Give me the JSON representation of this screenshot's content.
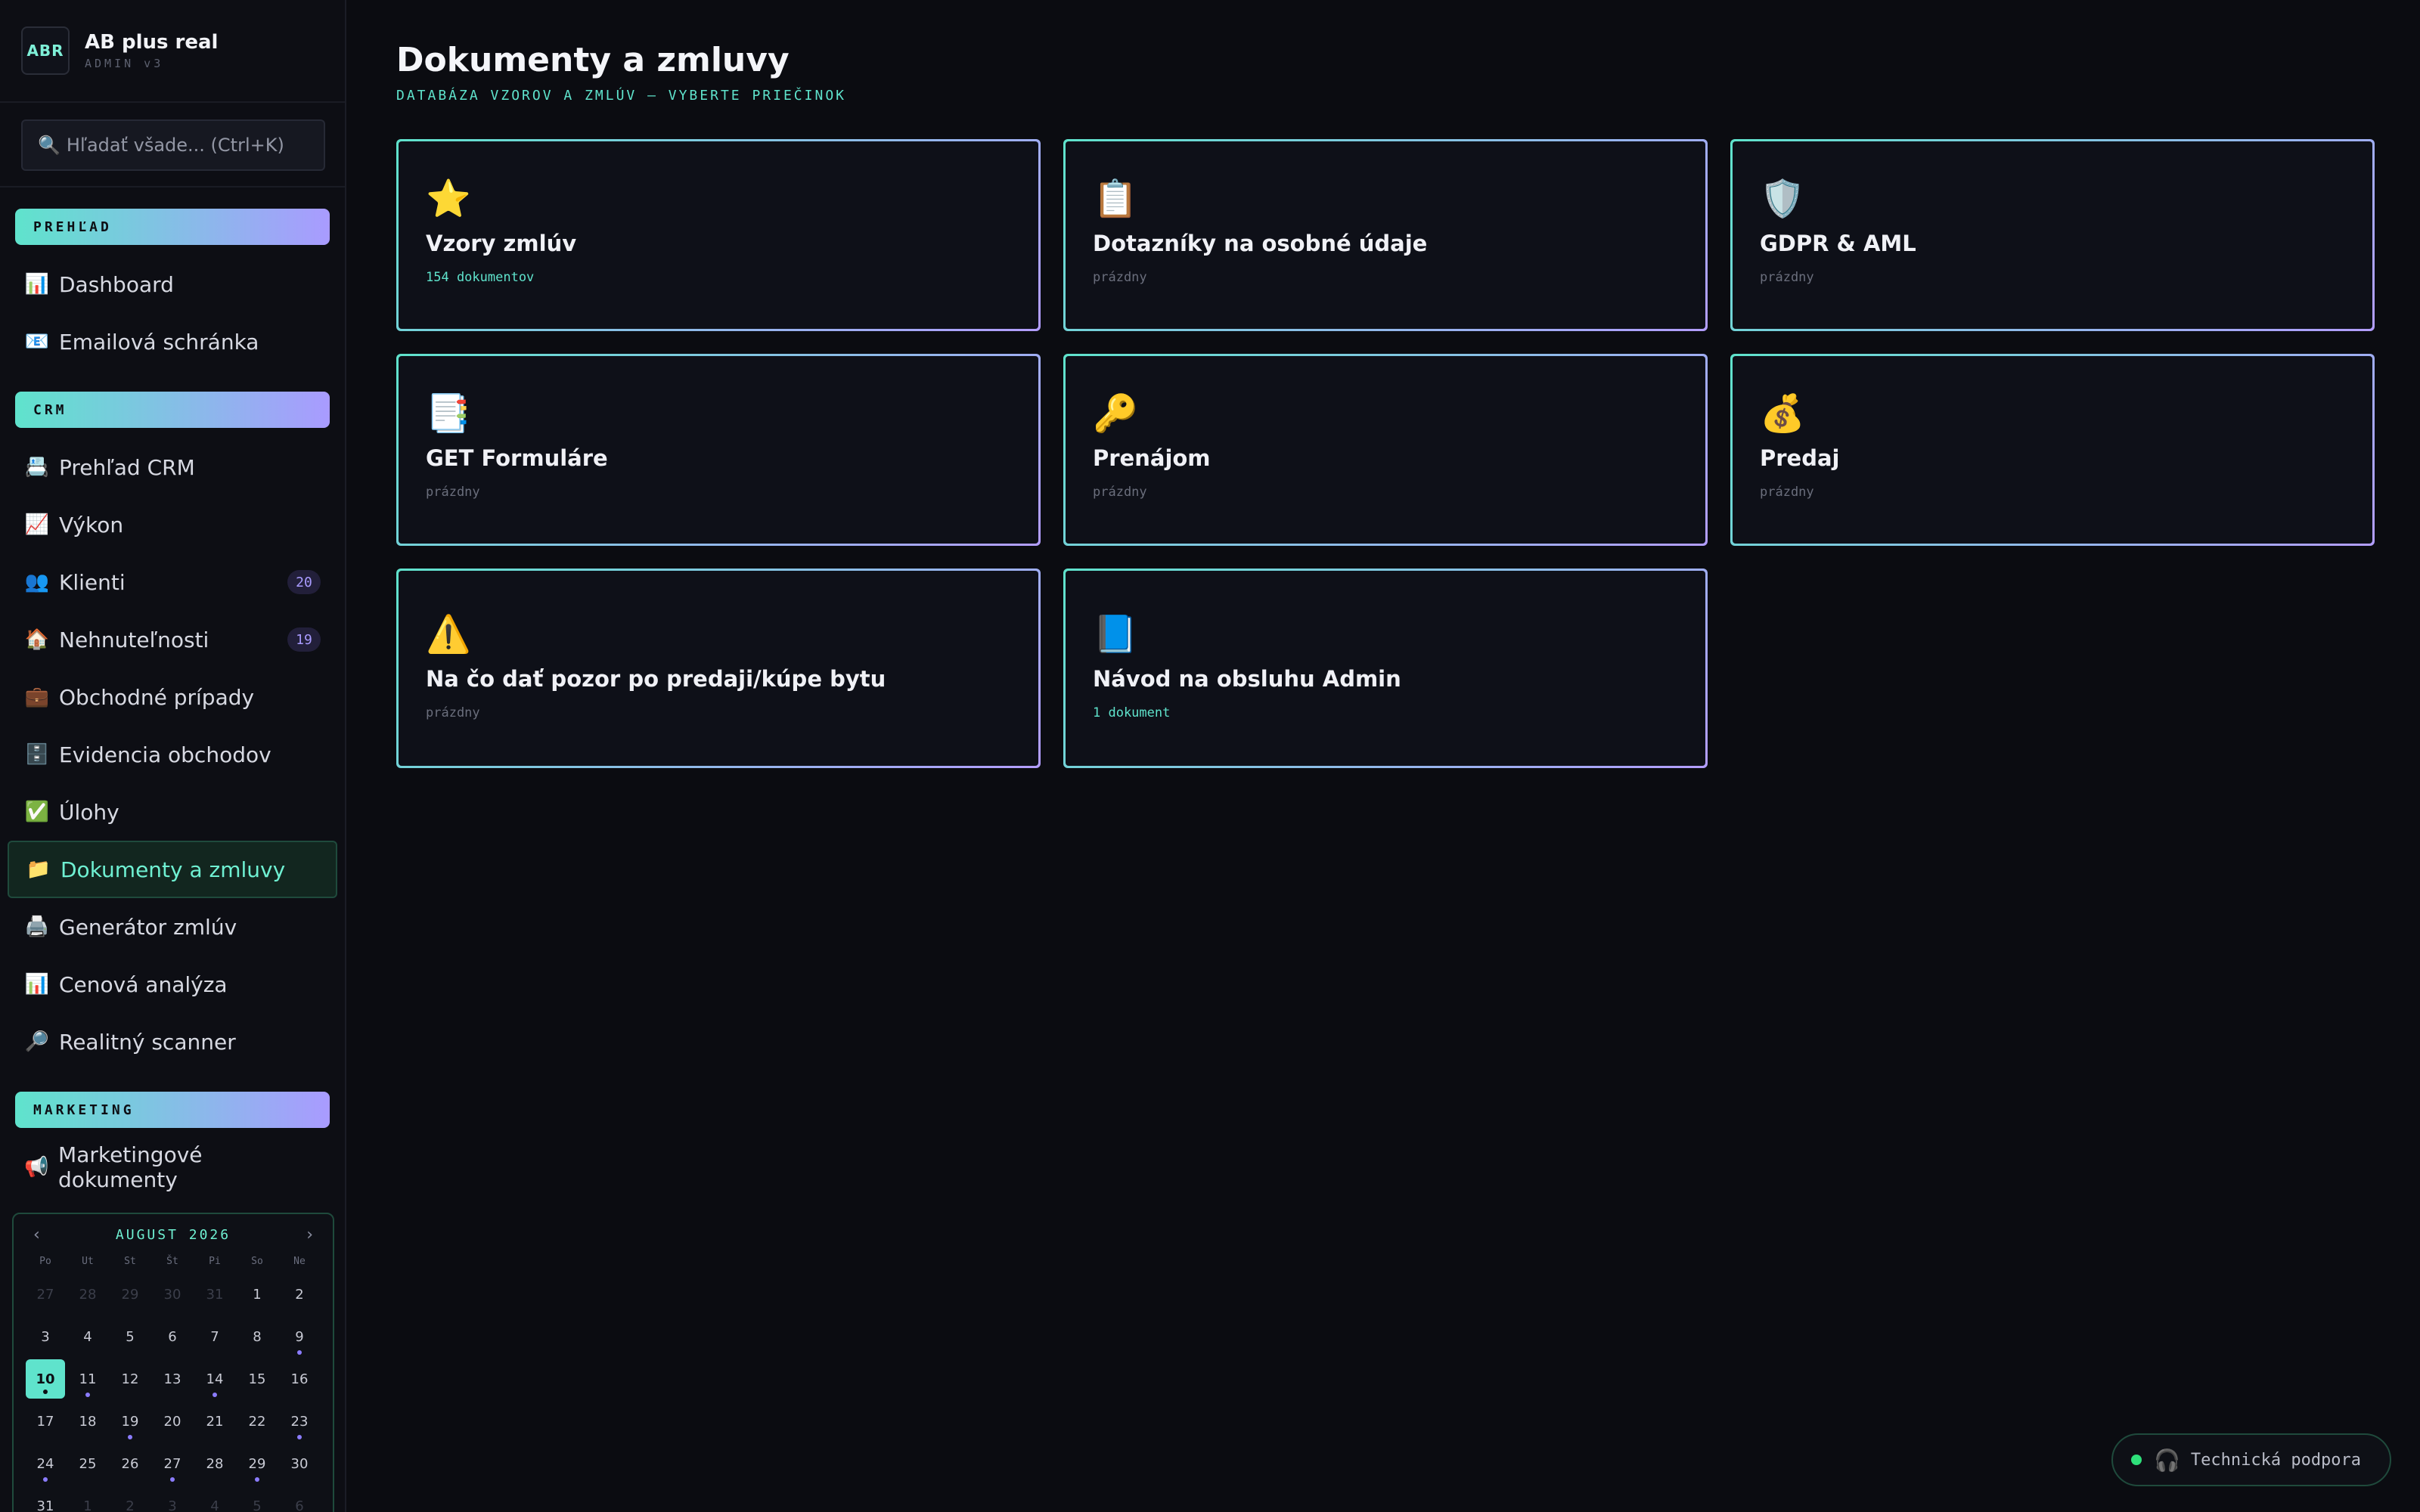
{
  "brand": {
    "logo": "ABR",
    "name": "AB plus real",
    "subtitle": "ADMIN v3"
  },
  "search": {
    "icon": "🔍",
    "placeholder": "Hľadať všade... (Ctrl+K)"
  },
  "sections": {
    "overview": "PREHĽAD",
    "crm": "CRM",
    "marketing": "MARKETING"
  },
  "nav_overview": [
    {
      "icon": "📊",
      "label": "Dashboard"
    },
    {
      "icon": "📧",
      "label": "Emailová schránka"
    }
  ],
  "nav_crm": [
    {
      "icon": "📇",
      "label": "Prehľad CRM"
    },
    {
      "icon": "📈",
      "label": "Výkon"
    },
    {
      "icon": "👥",
      "label": "Klienti",
      "badge": "20"
    },
    {
      "icon": "🏠",
      "label": "Nehnuteľnosti",
      "badge": "19"
    },
    {
      "icon": "💼",
      "label": "Obchodné prípady"
    },
    {
      "icon": "🗄️",
      "label": "Evidencia obchodov"
    },
    {
      "icon": "✅",
      "label": "Úlohy"
    },
    {
      "icon": "📁",
      "label": "Dokumenty a zmluvy",
      "active": true
    },
    {
      "icon": "🖨️",
      "label": "Generátor zmlúv"
    },
    {
      "icon": "📊",
      "label": "Cenová analýza"
    },
    {
      "icon": "🔎",
      "label": "Realitný scanner"
    }
  ],
  "nav_marketing": [
    {
      "icon": "📢",
      "label": "Marketingové dokumenty"
    }
  ],
  "calendar": {
    "prev": "‹",
    "next": "›",
    "month": "AUGUST 2026",
    "weekdays": [
      "Po",
      "Ut",
      "St",
      "Št",
      "Pi",
      "So",
      "Ne"
    ],
    "days": [
      {
        "d": "27",
        "muted": true
      },
      {
        "d": "28",
        "muted": true
      },
      {
        "d": "29",
        "muted": true
      },
      {
        "d": "30",
        "muted": true
      },
      {
        "d": "31",
        "muted": true
      },
      {
        "d": "1"
      },
      {
        "d": "2"
      },
      {
        "d": "3"
      },
      {
        "d": "4"
      },
      {
        "d": "5"
      },
      {
        "d": "6"
      },
      {
        "d": "7"
      },
      {
        "d": "8"
      },
      {
        "d": "9",
        "dot": true
      },
      {
        "d": "10",
        "today": true,
        "dot": true
      },
      {
        "d": "11",
        "dot": true
      },
      {
        "d": "12"
      },
      {
        "d": "13"
      },
      {
        "d": "14",
        "dot": true
      },
      {
        "d": "15"
      },
      {
        "d": "16"
      },
      {
        "d": "17"
      },
      {
        "d": "18"
      },
      {
        "d": "19",
        "dot": true
      },
      {
        "d": "20"
      },
      {
        "d": "21"
      },
      {
        "d": "22"
      },
      {
        "d": "23",
        "dot": true
      },
      {
        "d": "24",
        "dot": true
      },
      {
        "d": "25"
      },
      {
        "d": "26"
      },
      {
        "d": "27",
        "dot": true
      },
      {
        "d": "28"
      },
      {
        "d": "29",
        "dot": true
      },
      {
        "d": "30"
      },
      {
        "d": "31"
      },
      {
        "d": "1",
        "muted": true
      },
      {
        "d": "2",
        "muted": true
      },
      {
        "d": "3",
        "muted": true
      },
      {
        "d": "4",
        "muted": true
      },
      {
        "d": "5",
        "muted": true
      },
      {
        "d": "6",
        "muted": true
      }
    ]
  },
  "page": {
    "title": "Dokumenty a zmluvy",
    "subtitle": "DATABÁZA VZOROV A ZMLÚV — VYBERTE PRIEČINOK"
  },
  "folders": [
    {
      "icon": "⭐",
      "name": "Vzory zmlúv",
      "meta": "154 dokumentov",
      "has": true,
      "icon_name": "star-icon"
    },
    {
      "icon": "📋",
      "name": "Dotazníky na osobné údaje",
      "meta": "prázdny",
      "has": false,
      "icon_name": "clipboard-icon"
    },
    {
      "icon": "🛡️",
      "name": "GDPR & AML",
      "meta": "prázdny",
      "has": false,
      "icon_name": "shield-icon"
    },
    {
      "icon": "📑",
      "name": "GET Formuláre",
      "meta": "prázdny",
      "has": false,
      "icon_name": "forms-icon"
    },
    {
      "icon": "🔑",
      "name": "Prenájom",
      "meta": "prázdny",
      "has": false,
      "icon_name": "key-icon"
    },
    {
      "icon": "💰",
      "name": "Predaj",
      "meta": "prázdny",
      "has": false,
      "icon_name": "money-bag-icon"
    },
    {
      "icon": "⚠️",
      "name": "Na čo dať pozor po predaji/kúpe bytu",
      "meta": "prázdny",
      "has": false,
      "icon_name": "warning-icon"
    },
    {
      "icon": "📘",
      "name": "Návod na obsluhu Admin",
      "meta": "1 dokument",
      "has": true,
      "icon_name": "book-icon"
    }
  ],
  "support": {
    "icon": "🎧",
    "label": "Technická podpora",
    "status_color": "#2ee07a"
  },
  "colors": {
    "accent": "#5fe3cc",
    "accent2": "#a99bff",
    "background": "#0b0c11"
  }
}
